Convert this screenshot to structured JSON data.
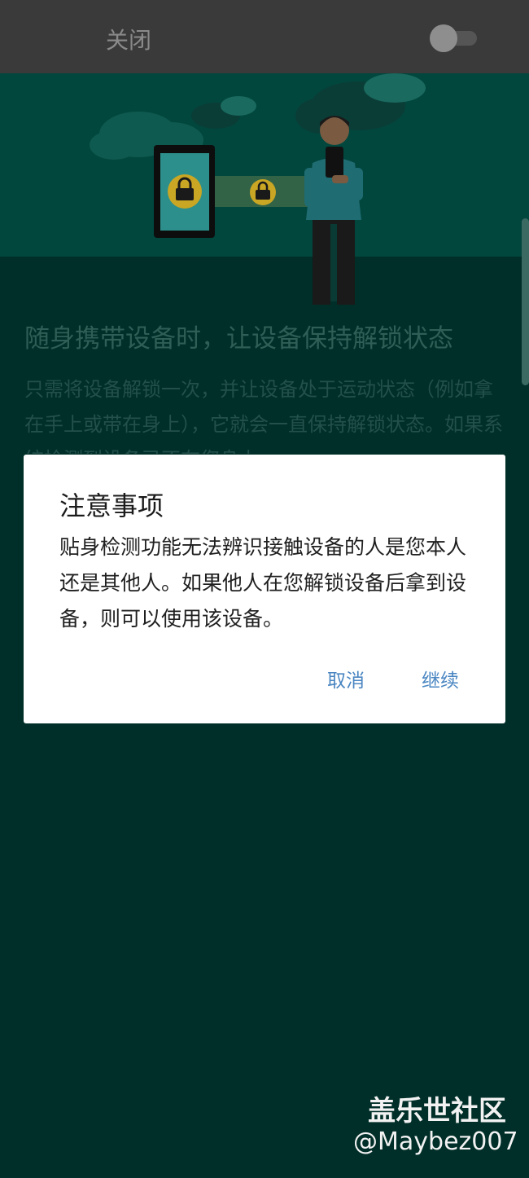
{
  "topbar": {
    "title": "关闭",
    "toggle_on": false
  },
  "background": {
    "heading": "随身携带设备时，让设备保持解锁状态",
    "body": "只需将设备解锁一次，并让设备处于运动状态（例如拿在手上或带在身上），它就会一直保持解锁状态。如果系统检测到设备已不在您身上"
  },
  "dialog": {
    "title": "注意事项",
    "message": "贴身检测功能无法辨识接触设备的人是您本人还是其他人。如果他人在您解锁设备后拿到设备，则可以使用该设备。",
    "cancel_label": "取消",
    "continue_label": "继续"
  },
  "watermark": {
    "site": "盖乐世社区",
    "user": "@Maybez007"
  },
  "colors": {
    "accent": "#4a86c2",
    "illustration_bg": "#01473e",
    "content_bg": "#002e28",
    "lock_yellow": "#c9a623"
  },
  "icons": [
    "lock-icon",
    "phone-illustration",
    "person-illustration",
    "cloud-illustration"
  ]
}
